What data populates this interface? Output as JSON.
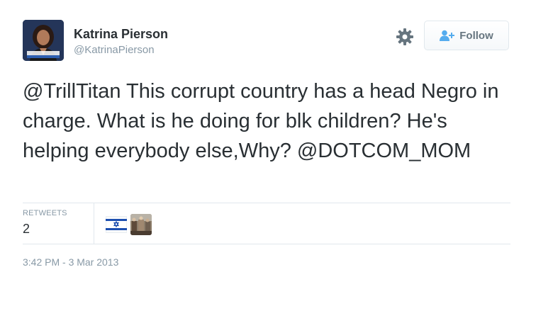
{
  "author": {
    "name": "Katrina Pierson",
    "handle": "@KatrinaPierson"
  },
  "actions": {
    "follow_label": "Follow",
    "gear_icon": "gear-icon",
    "follow_icon": "person-add-icon"
  },
  "tweet": {
    "text": "@TrillTitan This corrupt country has a head Negro in charge. What is he doing for blk children? He's helping everybody else,Why? @DOTCOM_MOM"
  },
  "stats": {
    "retweets_label": "RETWEETS",
    "retweets_count": "2",
    "retweeters": [
      "retweeter-avatar-flag",
      "retweeter-avatar-photo"
    ]
  },
  "timestamp": "3:42 PM - 3 Mar 2013",
  "colors": {
    "text": "#292f33",
    "muted": "#8899a6",
    "border": "#e1e8ed",
    "button_text": "#66757f"
  }
}
